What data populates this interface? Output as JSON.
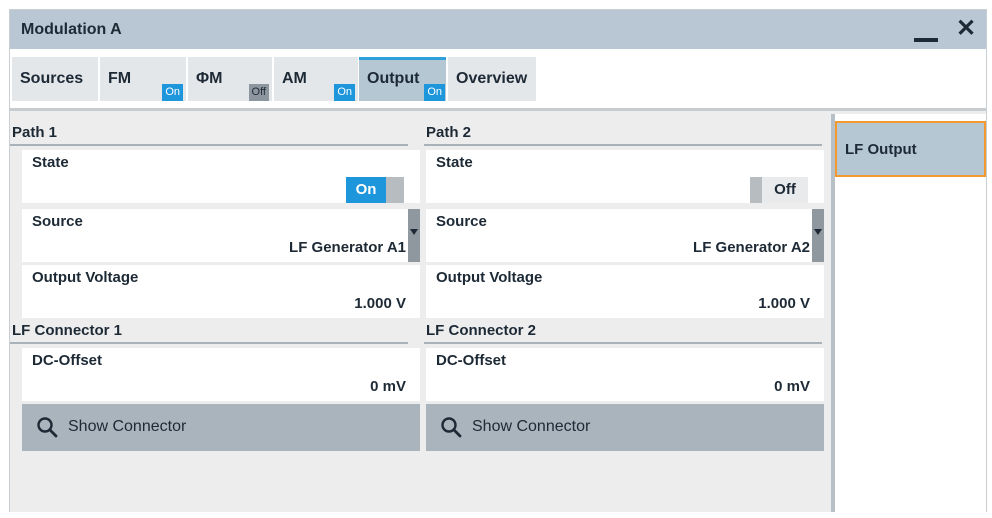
{
  "window": {
    "title": "Modulation A"
  },
  "tabs": [
    {
      "label": "Sources",
      "badge": ""
    },
    {
      "label": "FM",
      "badge": "On"
    },
    {
      "label": "ΦM",
      "badge": "Off"
    },
    {
      "label": "AM",
      "badge": "On"
    },
    {
      "label": "Output",
      "badge": "On",
      "active": true
    },
    {
      "label": "Overview",
      "badge": ""
    }
  ],
  "path1": {
    "title": "Path 1",
    "state_label": "State",
    "state_value": "On",
    "source_label": "Source",
    "source_value": "LF Generator A1",
    "voltage_label": "Output Voltage",
    "voltage_value": "1.000 V",
    "connector_title": "LF Connector 1",
    "offset_label": "DC-Offset",
    "offset_value": "0 mV",
    "show_connector": "Show Connector"
  },
  "path2": {
    "title": "Path 2",
    "state_label": "State",
    "state_value": "Off",
    "source_label": "Source",
    "source_value": "LF Generator A2",
    "voltage_label": "Output Voltage",
    "voltage_value": "1.000 V",
    "connector_title": "LF Connector 2",
    "offset_label": "DC-Offset",
    "offset_value": "0 mV",
    "show_connector": "Show Connector"
  },
  "side": {
    "item_label": "LF Output"
  },
  "icons": {
    "minimize": "minimize-icon",
    "close": "close-icon",
    "search": "search-icon",
    "dropdown": "chevron-down-icon"
  },
  "colors": {
    "on_badge": "#1d96dc",
    "off_badge": "#8d969e",
    "active_tab_accent": "#2ea0dc",
    "selected_outline": "#f29a2f",
    "titlebar": "#b8c7d3"
  }
}
